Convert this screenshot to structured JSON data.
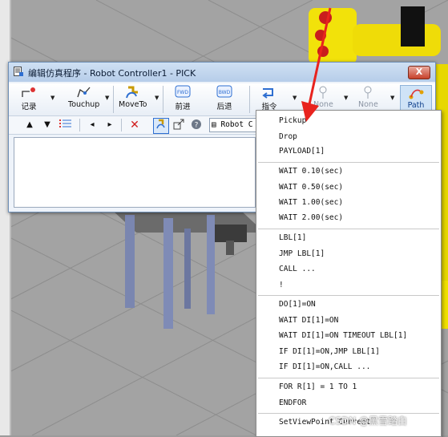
{
  "window": {
    "title": "编辑仿真程序 - Robot Controller1 - PICK",
    "close_label": "X"
  },
  "toolbar": {
    "record": "记录",
    "touchup": "Touchup",
    "moveto": "MoveTo",
    "forward": "前进",
    "backward": "后退",
    "forward_icon_text": "FWD",
    "backward_icon_text": "BWD",
    "instruction": "指令",
    "none1": "None",
    "none2": "None",
    "path": "Path"
  },
  "toolbar2": {
    "controller_combo": "Robot C"
  },
  "menu": {
    "group1": [
      "Pickup",
      "Drop",
      "PAYLOAD[1]"
    ],
    "group2": [
      "WAIT 0.10(sec)",
      "WAIT 0.50(sec)",
      "WAIT 1.00(sec)",
      "WAIT 2.00(sec)"
    ],
    "group3": [
      "LBL[1]",
      "JMP LBL[1]",
      "CALL ...",
      "!"
    ],
    "group4": [
      "DO[1]=ON",
      "WAIT DI[1]=ON",
      "WAIT DI[1]=ON TIMEOUT LBL[1]",
      "IF DI[1]=ON,JMP LBL[1]",
      "IF DI[1]=ON,CALL ..."
    ],
    "group5": [
      "FOR R[1] = 1 TO 1",
      "ENDFOR"
    ],
    "group6": [
      "SetViewPoint Current"
    ]
  },
  "watermark": "CSDN @黑雪踏白",
  "colors": {
    "accent": "#2f6fd1",
    "arrow": "#e8231e",
    "robot": "#f2e20a"
  }
}
